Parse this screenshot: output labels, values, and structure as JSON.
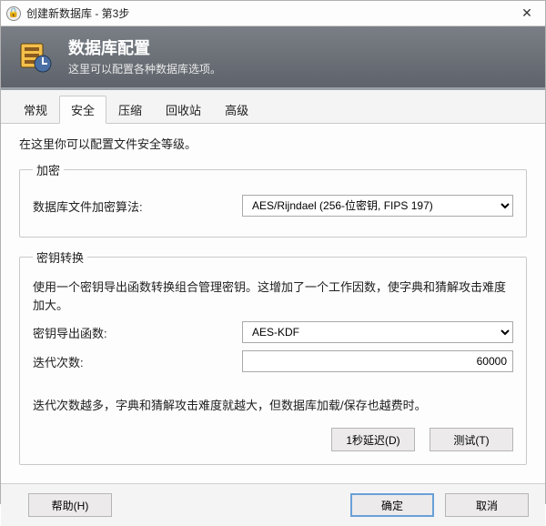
{
  "window": {
    "title": "创建新数据库  -  第3步"
  },
  "header": {
    "title": "数据库配置",
    "subtitle": "这里可以配置各种数据库选项。"
  },
  "tabs": [
    {
      "label": "常规"
    },
    {
      "label": "安全"
    },
    {
      "label": "压缩"
    },
    {
      "label": "回收站"
    },
    {
      "label": "高级"
    }
  ],
  "active_tab": 1,
  "security": {
    "intro": "在这里你可以配置文件安全等级。",
    "encryption": {
      "legend": "加密",
      "algo_label": "数据库文件加密算法:",
      "algo_value": "AES/Rijndael (256-位密钥, FIPS 197)"
    },
    "kdf": {
      "legend": "密钥转换",
      "desc": "使用一个密钥导出函数转换组合管理密钥。这增加了一个工作因数，使字典和猜解攻击难度加大。",
      "fn_label": "密钥导出函数:",
      "fn_value": "AES-KDF",
      "iter_label": "迭代次数:",
      "iter_value": "60000",
      "hint": "迭代次数越多，字典和猜解攻击难度就越大，但数据库加载/保存也越费时。",
      "delay_btn": "1秒延迟(D)",
      "test_btn": "测试(T)"
    }
  },
  "footer": {
    "help": "帮助(H)",
    "ok": "确定",
    "cancel": "取消"
  }
}
